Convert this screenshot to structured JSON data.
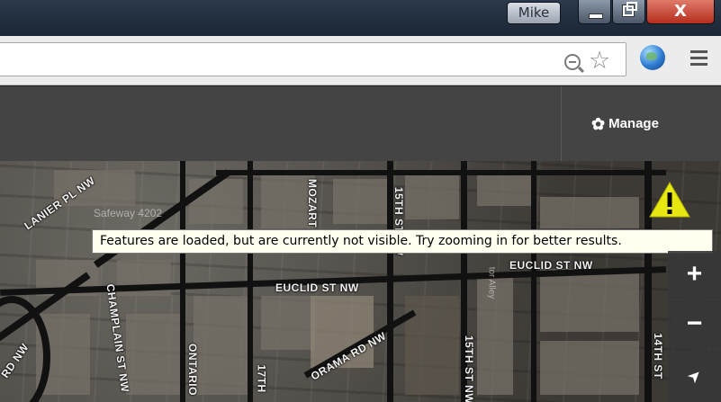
{
  "window": {
    "user_name": "Mike",
    "close_label": "X"
  },
  "browser": {
    "address_value": "",
    "icons": [
      "zoom-out-icon",
      "star-icon",
      "globe-icon",
      "menu-icon"
    ]
  },
  "header": {
    "manage_label": "Manage",
    "manage_icon": "gear-icon"
  },
  "map": {
    "roads": [
      "LANIER PL NW",
      "MOZART",
      "CHAMPLAIN ST NW",
      "EUCLID ST NW",
      "EUCLID ST NW",
      "ONTARIO",
      "17TH",
      "ORAMA RD NW",
      "15TH ST NW",
      "15TH ST NW",
      "14TH ST",
      "RD NW"
    ],
    "pois": [
      "Safeway 4202",
      "tor Alley"
    ],
    "warning_tooltip": "Features are loaded, but are currently not visible.  Try zooming in for better results.",
    "controls": {
      "zoom_in": "+",
      "zoom_out": "−",
      "locate": "➤"
    }
  },
  "colors": {
    "warning": "#e8e810",
    "header_bg": "#444444"
  }
}
